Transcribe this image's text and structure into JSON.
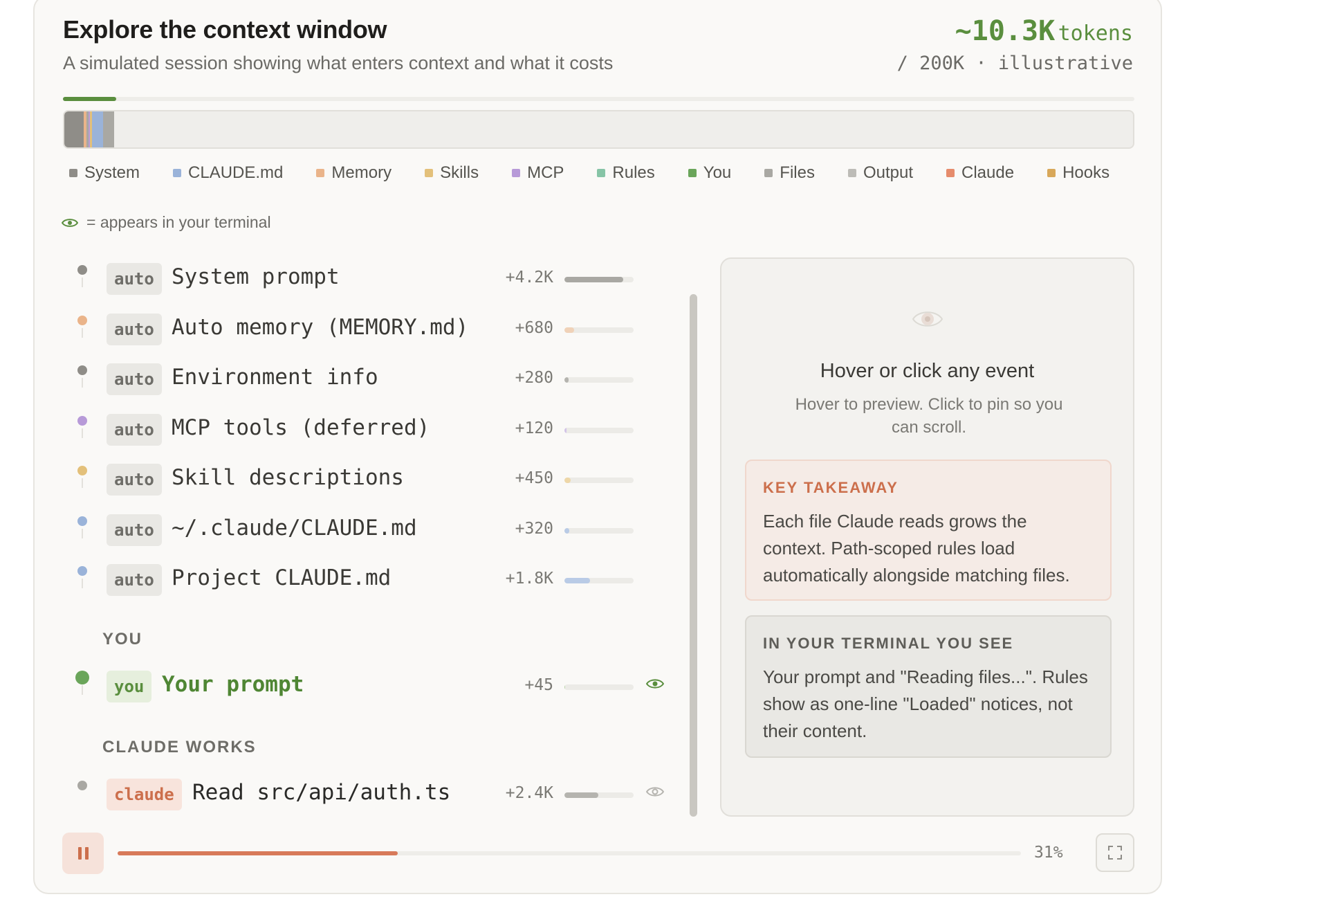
{
  "header": {
    "title": "Explore the context window",
    "subtitle": "A simulated session showing what enters context and what it costs",
    "tokens_value": "~10.3K",
    "tokens_unit": "tokens",
    "tokens_sub": "/ 200K · illustrative",
    "usage_fraction": 0.05
  },
  "legend": [
    {
      "label": "System",
      "color": "#8f8d88"
    },
    {
      "label": "CLAUDE.md",
      "color": "#9ab3d9"
    },
    {
      "label": "Memory",
      "color": "#eab48a"
    },
    {
      "label": "Skills",
      "color": "#e3c07a"
    },
    {
      "label": "MCP",
      "color": "#b79ad8"
    },
    {
      "label": "Rules",
      "color": "#86c4a6"
    },
    {
      "label": "You",
      "color": "#6aa55a"
    },
    {
      "label": "Files",
      "color": "#a9a8a3"
    },
    {
      "label": "Output",
      "color": "#bdbcb7"
    },
    {
      "label": "Claude",
      "color": "#e68c6c"
    },
    {
      "label": "Hooks",
      "color": "#d8a85a"
    }
  ],
  "eye_note": "= appears in your terminal",
  "events_auto": [
    {
      "badge": "auto",
      "label": "System prompt",
      "count": "+4.2K",
      "fill": 0.85,
      "color": "#a9a8a3",
      "dot": "#8f8d88"
    },
    {
      "badge": "auto",
      "label": "Auto memory (MEMORY.md)",
      "count": "+680",
      "fill": 0.14,
      "color": "#f0d2b8",
      "dot": "#eab48a"
    },
    {
      "badge": "auto",
      "label": "Environment info",
      "count": "+280",
      "fill": 0.06,
      "color": "#b5b4af",
      "dot": "#8f8d88"
    },
    {
      "badge": "auto",
      "label": "MCP tools (deferred)",
      "count": "+120",
      "fill": 0.03,
      "color": "#d3c4e8",
      "dot": "#b79ad8"
    },
    {
      "badge": "auto",
      "label": "Skill descriptions",
      "count": "+450",
      "fill": 0.09,
      "color": "#eed7a8",
      "dot": "#e3c07a"
    },
    {
      "badge": "auto",
      "label": "~/.claude/CLAUDE.md",
      "count": "+320",
      "fill": 0.07,
      "color": "#b9cbe6",
      "dot": "#9ab3d9"
    },
    {
      "badge": "auto",
      "label": "Project CLAUDE.md",
      "count": "+1.8K",
      "fill": 0.37,
      "color": "#b9cbe6",
      "dot": "#9ab3d9"
    }
  ],
  "section_you": "YOU",
  "event_you": {
    "badge": "you",
    "label": "Your prompt",
    "count": "+45",
    "fill": 0.01
  },
  "section_claude": "CLAUDE WORKS",
  "event_claude": {
    "badge": "claude",
    "label": "Read src/api/auth.ts",
    "count": "+2.4K",
    "fill": 0.49
  },
  "detail": {
    "heading": "Hover or click any event",
    "text": "Hover to preview. Click to pin so you can scroll.",
    "takeaway_title": "KEY TAKEAWAY",
    "takeaway_text": "Each file Claude reads grows the context. Path-scoped rules load automatically alongside matching files.",
    "terminal_title": "IN YOUR TERMINAL YOU SEE",
    "terminal_text": "Your prompt and \"Reading files...\". Rules show as one-line \"Loaded\" notices, not their content."
  },
  "playback": {
    "percent_label": "31%",
    "progress": 0.31
  }
}
